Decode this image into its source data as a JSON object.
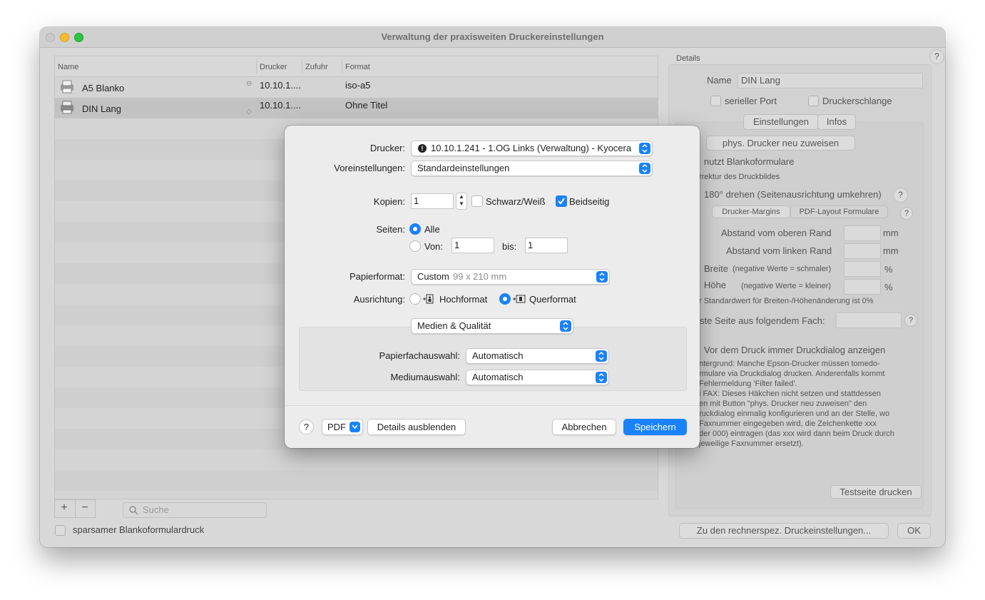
{
  "window": {
    "title": "Verwaltung der praxisweiten Druckereinstellungen"
  },
  "table": {
    "columns": [
      "Name",
      "Drucker",
      "Zufuhr",
      "Format"
    ],
    "rows": [
      {
        "name": "A5 Blanko",
        "drucker": "10.10.1....",
        "zufuhr": "",
        "format": "iso-a5"
      },
      {
        "name": "DIN Lang",
        "drucker": "10.10.1....",
        "zufuhr": "",
        "format": "Ohne Titel"
      }
    ]
  },
  "bottom": {
    "add": "+",
    "remove": "−",
    "search_placeholder": "Suche",
    "sparsam_label": "sparsamer Blankoformulardruck"
  },
  "details": {
    "section_label": "Details",
    "help": "?",
    "name_label": "Name",
    "name_value": "DIN Lang",
    "serial_port": "serieller Port",
    "druckerschlange": "Druckerschlange",
    "tabs": [
      "Einstellungen",
      "Infos"
    ],
    "reassign_button": "phys. Drucker neu zuweisen",
    "blank_forms": "nutzt Blankoformulare",
    "correction_label": "rrektur des Druckbildes",
    "rotate_label": "180° drehen (Seitenausrichtung umkehren)",
    "subtabs": [
      "Drucker-Margins",
      "PDF-Layout Formulare"
    ],
    "top_margin": "Abstand vom oberen Rand",
    "left_margin": "Abstand vom linken Rand",
    "mm": "mm",
    "width_label": "Breite",
    "width_hint": "(negative Werte = schmaler)",
    "height_label": "Höhe",
    "height_hint": "(negative Werte = kleiner)",
    "percent": "%",
    "default_note": "r Standardwert für Breiten-/Höhenänderung ist 0%",
    "first_page": "ste Seite aus folgendem Fach:",
    "dialog_check": "Vor dem Druck immer Druckdialog anzeigen",
    "info_lines": [
      "ntergrund: Manche Epson-Drucker müssen tomedo-",
      "rmulare via Druckdialog drucken. Anderenfalls kommt",
      "Fehlermeldung 'Filter failed'.",
      "i FAX: Dieses Häkchen nicht setzen und stattdessen",
      "en mit Button \"phys. Drucker neu zuweisen\" den",
      "ruckdialog einmalig konfigurieren und an der Stelle, wo",
      "Faxnummer eingegeben wird, die Zeichenkette xxx",
      "der 000) eintragen (das xxx wird dann beim Druck durch",
      "jeweilige Faxnummer ersetzt)."
    ],
    "test_print": "Testseite drucken",
    "computer_settings": "Zu den rechnerspez. Druckeinstellungen...",
    "ok": "OK"
  },
  "dialog": {
    "printer_label": "Drucker:",
    "printer_value": "10.10.1.241 - 1.OG Links (Verwaltung) - Kyocera",
    "presets_label": "Voreinstellungen:",
    "presets_value": "Standardeinstellungen",
    "copies_label": "Kopien:",
    "copies_value": "1",
    "bw_label": "Schwarz/Weiß",
    "duplex_label": "Beidseitig",
    "pages_label": "Seiten:",
    "all_label": "Alle",
    "from_label": "Von:",
    "from_value": "1",
    "to_label": "bis:",
    "to_value": "1",
    "paper_label": "Papierformat:",
    "paper_value": "Custom",
    "paper_dims": "99 x 210 mm",
    "orientation_label": "Ausrichtung:",
    "portrait": "Hochformat",
    "landscape": "Querformat",
    "section_popup": "Medien & Qualität",
    "tray_label": "Papierfachauswahl:",
    "tray_value": "Automatisch",
    "media_label": "Mediumauswahl:",
    "media_value": "Automatisch",
    "help": "?",
    "pdf": "PDF",
    "hide_details": "Details ausblenden",
    "cancel": "Abbrechen",
    "save": "Speichern"
  }
}
